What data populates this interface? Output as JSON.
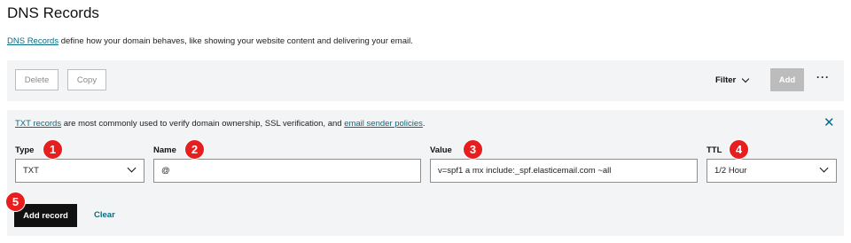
{
  "header": {
    "title": "DNS Records"
  },
  "intro": {
    "link_text": "DNS Records",
    "text": " define how your domain behaves, like showing your website content and delivering your email."
  },
  "toolbar": {
    "delete_label": "Delete",
    "copy_label": "Copy",
    "filter_label": "Filter",
    "add_label": "Add",
    "more_label": "···"
  },
  "note": {
    "link1": "TXT records",
    "text1": " are most commonly used to verify domain ownership, SSL verification, and ",
    "link2": "email sender policies",
    "text2": "."
  },
  "form": {
    "type": {
      "label": "Type",
      "value": "TXT"
    },
    "name": {
      "label": "Name",
      "value": "@"
    },
    "value": {
      "label": "Value",
      "value": "v=spf1 a mx include:_spf.elasticemail.com ~all"
    },
    "ttl": {
      "label": "TTL",
      "value": "1/2 Hour"
    },
    "save_label": "Add record",
    "clear_label": "Clear"
  },
  "annotations": [
    "1",
    "2",
    "3",
    "4",
    "5"
  ],
  "colors": {
    "accent": "#0a6b82",
    "badge": "#e81e1e",
    "primary_button": "#111111",
    "panel_bg": "#f3f4f5"
  }
}
